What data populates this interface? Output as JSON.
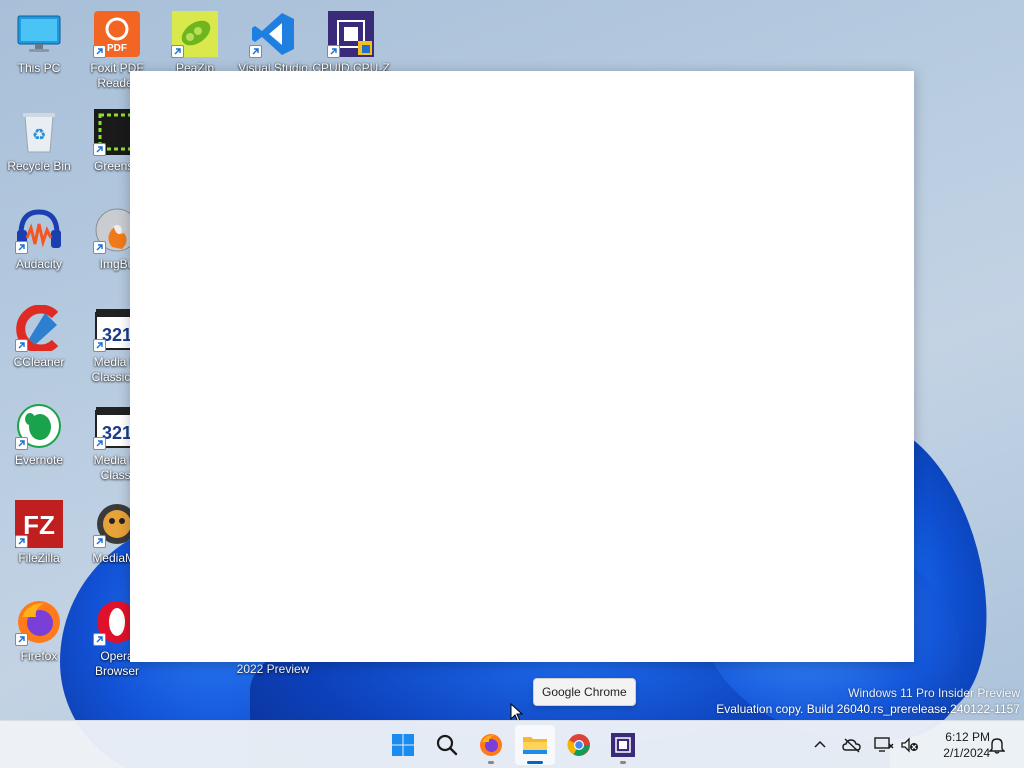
{
  "desktop": {
    "icons": [
      {
        "label": "This PC",
        "icon": "monitor-icon"
      },
      {
        "label": "Foxit PDF Reader",
        "icon": "foxit-pdf-icon"
      },
      {
        "label": "PeaZip",
        "icon": "peazip-icon"
      },
      {
        "label": "Visual Studio 2022 Preview",
        "icon": "visual-studio-icon"
      },
      {
        "label": "CPUID CPU-Z",
        "icon": "cpu-z-icon"
      },
      {
        "label": "Recycle Bin",
        "icon": "recycle-bin-icon"
      },
      {
        "label": "Greensh",
        "icon": "greenshot-icon"
      },
      {
        "label": "Audacity",
        "icon": "audacity-icon"
      },
      {
        "label": "ImgBu",
        "icon": "imgburn-icon"
      },
      {
        "label": "CCleaner",
        "icon": "ccleaner-icon"
      },
      {
        "label": "Media Pl Classic H",
        "icon": "mpc-hc-icon"
      },
      {
        "label": "Evernote",
        "icon": "evernote-icon"
      },
      {
        "label": "Media Pl Classi",
        "icon": "mpc-be-icon"
      },
      {
        "label": "FileZilla",
        "icon": "filezilla-icon"
      },
      {
        "label": "MediaMo",
        "icon": "mediamonkey-icon"
      },
      {
        "label": "Firefox",
        "icon": "firefox-icon"
      },
      {
        "label": "Opera Browser",
        "icon": "opera-icon"
      }
    ]
  },
  "vs_label_visible": "2022 Preview",
  "tooltip": "Google Chrome",
  "watermark": {
    "line1": "Windows 11 Pro Insider Preview",
    "line2": "Evaluation copy. Build 26040.rs_prerelease.240122-1157"
  },
  "taskbar": {
    "apps": [
      {
        "name": "Start",
        "icon": "windows-start-icon"
      },
      {
        "name": "Search",
        "icon": "search-icon"
      },
      {
        "name": "Firefox",
        "icon": "firefox-icon"
      },
      {
        "name": "File Explorer",
        "icon": "file-explorer-icon"
      },
      {
        "name": "Google Chrome",
        "icon": "chrome-icon"
      },
      {
        "name": "CPU-Z",
        "icon": "cpu-z-icon"
      }
    ],
    "tray": {
      "time": "6:12 PM",
      "date": "2/1/2024"
    }
  },
  "colors": {
    "accent": "#0067c0",
    "wallpaper_blue": "#1252d6"
  }
}
